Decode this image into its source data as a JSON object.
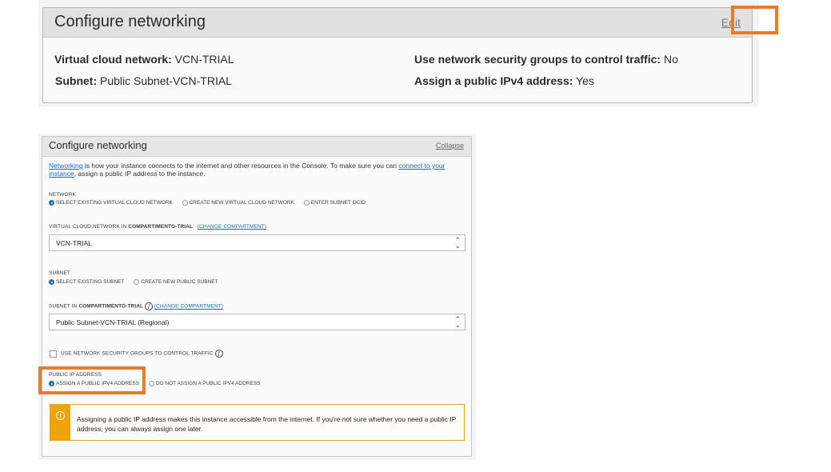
{
  "summary": {
    "title": "Configure networking",
    "edit_label": "Edit",
    "vcn_key": "Virtual cloud network:",
    "vcn_val": "VCN-TRIAL",
    "subnet_key": "Subnet:",
    "subnet_val": "Public Subnet-VCN-TRIAL",
    "nsg_key": "Use network security groups to control traffic:",
    "nsg_val": "No",
    "ipv4_key": "Assign a public IPv4 address:",
    "ipv4_val": "Yes"
  },
  "form": {
    "title": "Configure networking",
    "collapse_label": "Collapse",
    "intro_link1": "Networking",
    "intro_text1": " is how your instance connects to the internet and other resources in the Console. To make sure you can ",
    "intro_link2": "connect to your instance",
    "intro_text2": ", assign a public IP address to the instance.",
    "network_label": "NETWORK",
    "network_options": [
      "SELECT EXISTING VIRTUAL CLOUD NETWORK",
      "CREATE NEW VIRTUAL CLOUD NETWORK",
      "ENTER SUBNET OCID"
    ],
    "vcn_label_prefix": "VIRTUAL CLOUD NETWORK IN ",
    "vcn_label_comp": "COMPARTIMENTO-TRIAL",
    "change_compartment": "(CHANGE COMPARTMENT)",
    "vcn_value": "VCN-TRIAL",
    "subnet_label": "SUBNET",
    "subnet_options": [
      "SELECT EXISTING SUBNET",
      "CREATE NEW PUBLIC SUBNET"
    ],
    "subnet_in_prefix": "SUBNET IN ",
    "subnet_in_comp": "COMPARTIMENTO-TRIAL",
    "subnet_value": "Public Subnet-VCN-TRIAL (Regional)",
    "nsg_label": "USE NETWORK SECURITY GROUPS TO CONTROL TRAFFIC",
    "public_ip_label": "PUBLIC IP ADDRESS",
    "public_ip_options": [
      "ASSIGN A PUBLIC IPV4 ADDRESS",
      "DO NOT ASSIGN A PUBLIC IPV4 ADDRESS"
    ],
    "notice_text": "Assigning a public IP address makes this instance accessible from the internet. If you're not sure whether you need a public IP address, you can always assign one later."
  },
  "colors": {
    "highlight": "#e47b2f",
    "link": "#1f6bb8",
    "warning": "#f0a30a"
  }
}
